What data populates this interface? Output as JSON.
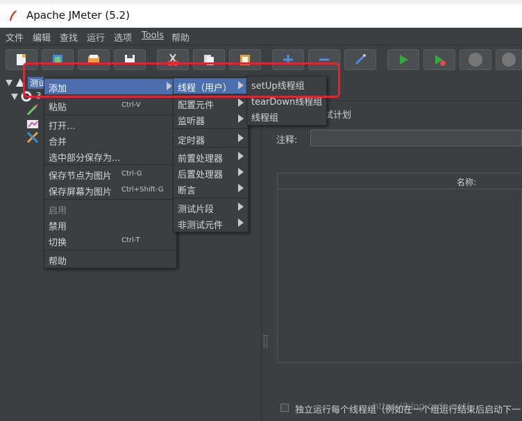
{
  "window": {
    "title": "Apache JMeter (5.2)"
  },
  "menubar": [
    "文件",
    "编辑",
    "查找",
    "运行",
    "选项",
    "Tools",
    "帮助"
  ],
  "colors": {
    "highlight": "#4b6eaf",
    "annotation_red": "#e0262b",
    "run_green": "#2fae3a"
  },
  "tree": {
    "root_label": "测试",
    "child_label": "3"
  },
  "context_menu": {
    "items": [
      {
        "label": "添加",
        "shortcut": ""
      },
      {
        "label": "粘贴",
        "shortcut": "Ctrl-V"
      },
      {
        "label": "打开...",
        "shortcut": ""
      },
      {
        "label": "合并",
        "shortcut": ""
      },
      {
        "label": "选中部分保存为...",
        "shortcut": ""
      },
      {
        "label": "保存节点为图片",
        "shortcut": "Ctrl-G"
      },
      {
        "label": "保存屏幕为图片",
        "shortcut": "Ctrl+Shift-G"
      },
      {
        "label": "启用",
        "shortcut": ""
      },
      {
        "label": "禁用",
        "shortcut": ""
      },
      {
        "label": "切换",
        "shortcut": "Ctrl-T"
      },
      {
        "label": "帮助",
        "shortcut": ""
      }
    ]
  },
  "add_submenu": {
    "items": [
      "线程（用户）",
      "配置元件",
      "监听器",
      "定时器",
      "前置处理器",
      "后置处理器",
      "断言",
      "测试片段",
      "非测试元件"
    ]
  },
  "thread_submenu": {
    "items": [
      "setUp线程组",
      "tearDown线程组",
      "线程组"
    ]
  },
  "right_panel": {
    "title_text": "试计划",
    "comment_label": "注释:",
    "table_header": "名称:",
    "checkbox_label": "独立运行每个线程组（例如在一个组运行结束后启动下一",
    "watermark": "https://blog.csdn.net/..."
  }
}
